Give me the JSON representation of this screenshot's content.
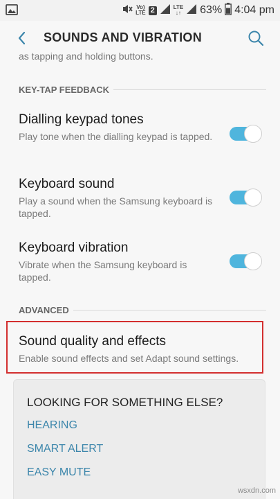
{
  "status_bar": {
    "volte_top": "Vo)",
    "volte_bottom": "LTE",
    "sim_badge": "2",
    "lte_top": "LTE",
    "lte_bottom": "↓↑",
    "battery": "63%",
    "time": "4:04 pm",
    "icons": [
      "image-icon",
      "mute-icon",
      "signal-icon",
      "battery-icon"
    ]
  },
  "header": {
    "title": "SOUNDS AND VIBRATION",
    "back_icon": "back-arrow-icon",
    "search_icon": "search-icon"
  },
  "previous_item_text": "as tapping and holding buttons.",
  "sections": {
    "key_tap": "KEY-TAP FEEDBACK",
    "advanced": "ADVANCED"
  },
  "items": [
    {
      "title": "Dialling keypad tones",
      "subtitle": "Play tone when the dialling keypad is tapped.",
      "enabled": true
    },
    {
      "title": "Keyboard sound",
      "subtitle": "Play a sound when the Samsung keyboard is tapped.",
      "enabled": true
    },
    {
      "title": "Keyboard vibration",
      "subtitle": "Vibrate when the Samsung keyboard is tapped.",
      "enabled": true
    }
  ],
  "sound_quality": {
    "title": "Sound quality and effects",
    "subtitle": "Enable sound effects and set Adapt sound settings."
  },
  "looking_for": {
    "title": "LOOKING FOR SOMETHING ELSE?",
    "links": [
      "HEARING",
      "SMART ALERT",
      "EASY MUTE"
    ]
  },
  "watermark": "wsxdn.com",
  "colors": {
    "accent": "#4fb5dd",
    "link": "#3c86ab",
    "highlight_border": "#d32f2f"
  }
}
